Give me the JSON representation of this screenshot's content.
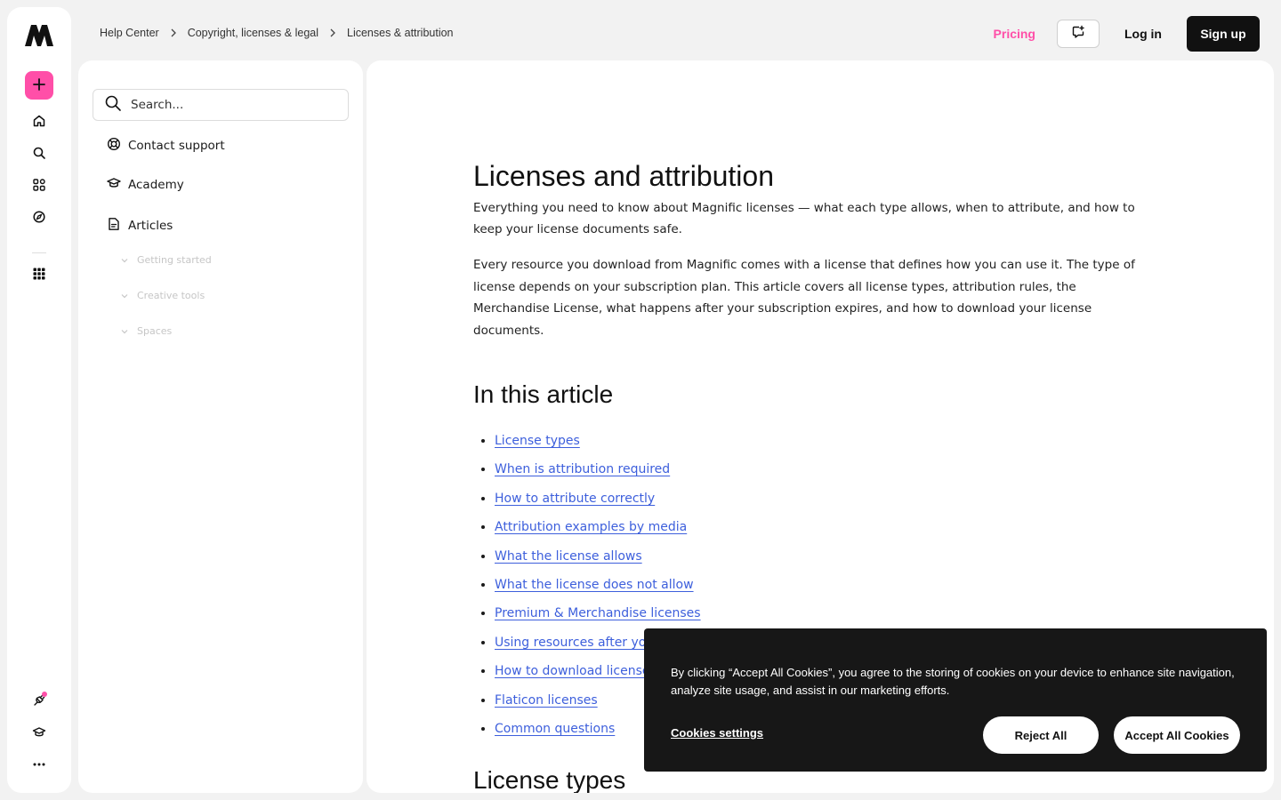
{
  "header": {
    "breadcrumbs": [
      "Help Center",
      "Copyright, licenses & legal",
      "Licenses & attribution"
    ],
    "pricing_label": "Pricing",
    "login_label": "Log in",
    "signup_label": "Sign up"
  },
  "sidebar": {
    "search_placeholder": "Search...",
    "contact_label": "Contact support",
    "academy_label": "Academy",
    "articles_label": "Articles",
    "sub_items": [
      "Getting started",
      "Creative tools",
      "Spaces"
    ]
  },
  "article": {
    "title": "Licenses and attribution",
    "intro": "Everything you need to know about Magnific licenses — what each type allows, when to attribute, and how to keep your license documents safe.",
    "paragraph": "Every resource you download from Magnific comes with a license that defines how you can use it. The type of license depends on your subscription plan. This article covers all license types, attribution rules, the Merchandise License, what happens after your subscription expires, and how to download your license documents.",
    "toc_heading": "In this article",
    "toc": [
      "License types",
      "When is attribution required",
      "How to attribute correctly",
      "Attribution examples by media",
      "What the license allows",
      "What the license does not allow",
      "Premium & Merchandise licenses",
      "Using resources after your subscription expires",
      "How to download license documents",
      "Flaticon licenses",
      "Common questions"
    ],
    "next_heading": "License types"
  },
  "cookie": {
    "message": "By clicking “Accept All Cookies”, you agree to the storing of cookies on your device to enhance site navigation, analyze site usage, and assist in our marketing efforts.",
    "settings_label": "Cookies settings",
    "reject_label": "Reject All",
    "accept_label": "Accept All Cookies"
  },
  "colors": {
    "accent_pink": "#ff4fa8",
    "link_blue": "#3d5fdc",
    "banner_bg": "#171717"
  },
  "icons": {
    "rail": [
      "logo-icon",
      "plus-icon",
      "home-icon",
      "search-icon",
      "apps-icon",
      "compass-icon",
      "grid-icon",
      "plug-icon",
      "graduation-cap-icon",
      "more-icon"
    ],
    "sidebar": [
      "search-icon",
      "lifebuoy-icon",
      "graduation-cap-icon",
      "document-icon",
      "chevron-down-icon"
    ]
  }
}
